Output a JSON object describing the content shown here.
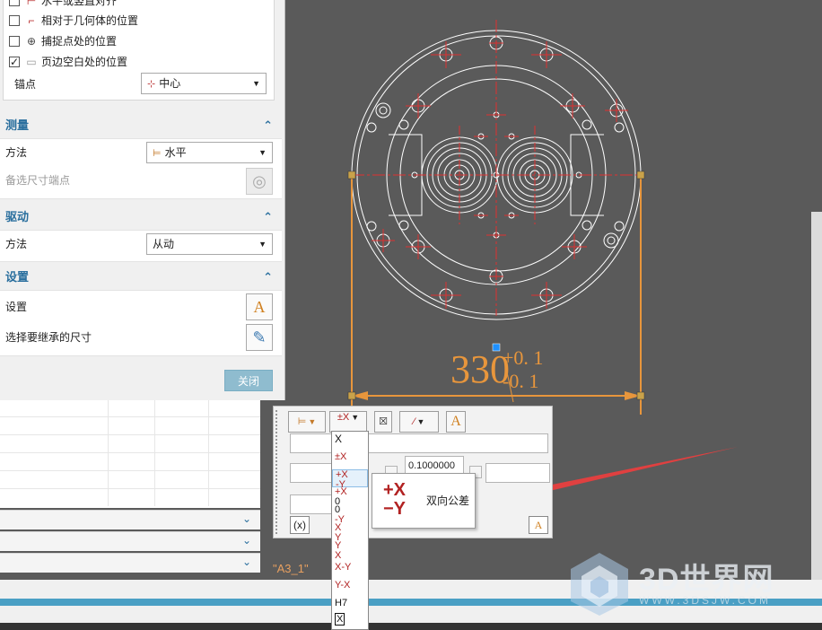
{
  "panel": {
    "top_options": [
      {
        "label": "水平或竖直对齐",
        "checked": false,
        "icon": "align-icon"
      },
      {
        "label": "相对于几何体的位置",
        "checked": false,
        "icon": "geometry-position-icon"
      },
      {
        "label": "捕捉点处的位置",
        "checked": false,
        "icon": "snap-point-icon"
      },
      {
        "label": "页边空白处的位置",
        "checked": true,
        "icon": "margin-position-icon"
      }
    ],
    "anchor": {
      "label": "锚点",
      "value": "中心"
    },
    "measure": {
      "title": "测量",
      "method_label": "方法",
      "method_value": "水平",
      "alt_endpoint_label": "备选尺寸端点"
    },
    "drive": {
      "title": "驱动",
      "method_label": "方法",
      "method_value": "从动"
    },
    "settings": {
      "title": "设置",
      "settings_label": "设置",
      "inherit_label": "选择要继承的尺寸"
    },
    "close_label": "关闭"
  },
  "drawing": {
    "dimension_value": "330",
    "upper_tolerance": "+0. 1",
    "lower_tolerance": "-0. 1",
    "sheet_label": "\"A3_1\""
  },
  "dimbar": {
    "value_field": "0.1000000"
  },
  "tolerance_list": [
    {
      "top": "X",
      "bottom": ""
    },
    {
      "top": "±X",
      "bottom": ""
    },
    {
      "top": "+X",
      "bottom": "-Y"
    },
    {
      "top": "+X",
      "bottom": "0"
    },
    {
      "top": "0",
      "bottom": "-Y"
    },
    {
      "top": "X",
      "bottom": "Y"
    },
    {
      "top": "Y",
      "bottom": "X"
    },
    {
      "top": "X-Y",
      "bottom": ""
    },
    {
      "top": "Y-X",
      "bottom": ""
    },
    {
      "top": "H7",
      "bottom": ""
    },
    {
      "top": "X",
      "bottom": ""
    }
  ],
  "tooltip": {
    "symbol_top": "+X",
    "symbol_bottom": "−Y",
    "label": "双向公差"
  },
  "watermark": {
    "text": "3D世界网",
    "url": "WWW.3DSJW.COM"
  },
  "colors": {
    "canvas": "#5a5a5a",
    "dimension": "#e8963c",
    "geometry": "#ffffff",
    "centerline": "#e03030",
    "accent": "#2a6f9e",
    "arrow": "#e04040"
  }
}
